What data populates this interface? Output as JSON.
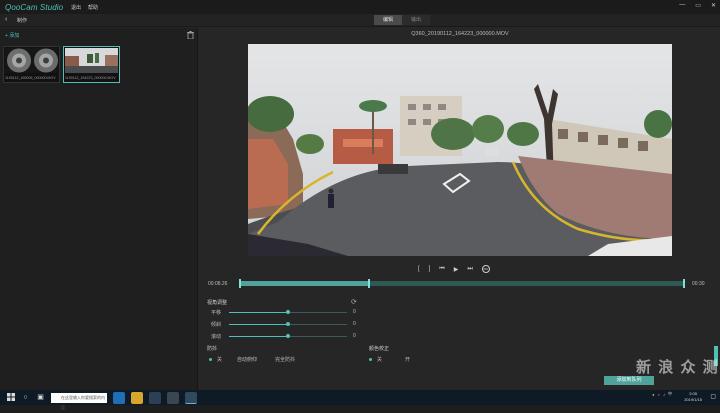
{
  "titlebar": {
    "logo": "QooCam Studio",
    "menus": [
      "退出",
      "帮助"
    ],
    "controls": [
      "—",
      "▭",
      "✕"
    ]
  },
  "subbar": {
    "back_icon": "‹",
    "title": "制作",
    "tabs": [
      {
        "label": "编辑",
        "active": true
      },
      {
        "label": "输出",
        "active": false
      }
    ]
  },
  "sidebar": {
    "add_label": "+ 添加",
    "trash_icon": "trash-icon",
    "thumbnails": [
      {
        "caption": "1190112_165005_000000.MOV",
        "selected": false
      },
      {
        "caption": "1190112_164223_000000.MOV",
        "selected": true
      }
    ]
  },
  "player": {
    "filename": "Q360_20190112_164223_000000.MOV",
    "time_current": "00:08.26",
    "time_total": "00:30",
    "progress": 0.29,
    "controls": [
      "[",
      "]",
      "⏮",
      "▶",
      "⏭",
      "360"
    ]
  },
  "adjust": {
    "title": "视角调整",
    "sliders": [
      {
        "label": "平移",
        "value": "0",
        "fraction": 0.5
      },
      {
        "label": "倾斜",
        "value": "0",
        "fraction": 0.5
      },
      {
        "label": "滚动",
        "value": "0",
        "fraction": 0.5
      }
    ]
  },
  "stabilize": {
    "title": "防抖",
    "options": [
      {
        "label": "关",
        "selected": true
      },
      {
        "label": "自动俯仰",
        "selected": false
      },
      {
        "label": "完全防抖",
        "selected": false
      }
    ]
  },
  "color": {
    "title": "颜色校正",
    "options": [
      {
        "label": "关",
        "selected": true
      },
      {
        "label": "开",
        "selected": false
      }
    ]
  },
  "export_label": "添加到队列",
  "watermark": "新 浪 众 测",
  "taskbar": {
    "search_placeholder": "在这里输入你要搜索的内容",
    "clock_time": "2:05",
    "clock_date": "2019/1/15",
    "ime": "中"
  },
  "colors": {
    "accent": "#4fc0b8",
    "background": "#262626"
  }
}
